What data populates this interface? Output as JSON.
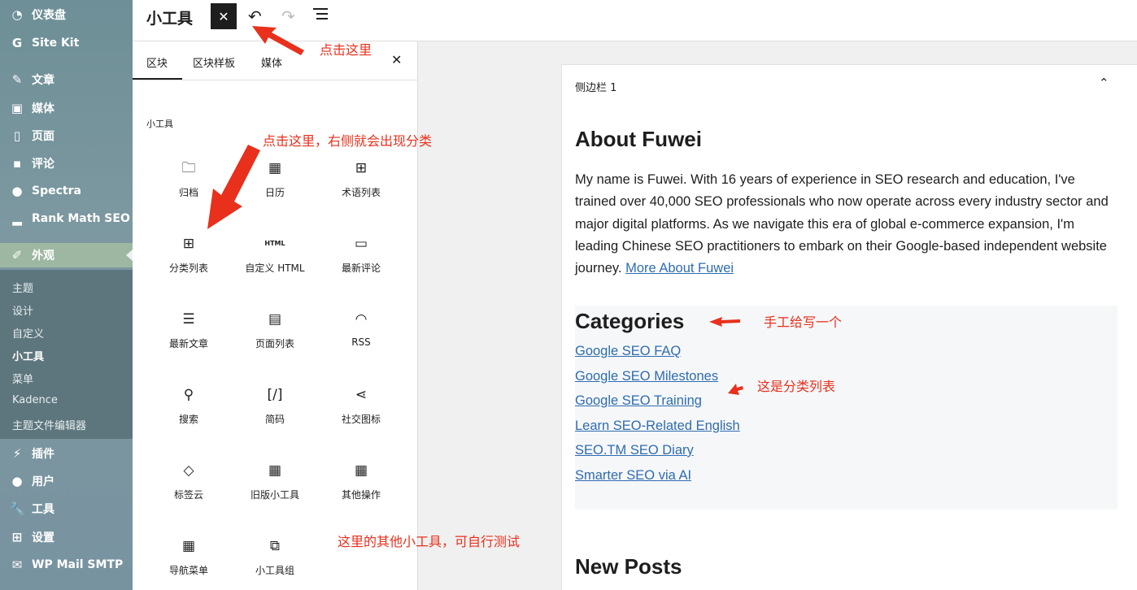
{
  "sidebar": {
    "items": [
      {
        "label": "仪表盘",
        "icon": "dashboard-icon"
      },
      {
        "label": "Site Kit",
        "icon": "google-icon"
      },
      {
        "label": "文章",
        "icon": "pin-icon"
      },
      {
        "label": "媒体",
        "icon": "media-icon"
      },
      {
        "label": "页面",
        "icon": "pages-icon"
      },
      {
        "label": "评论",
        "icon": "comments-icon"
      },
      {
        "label": "Spectra",
        "icon": "spectra-icon"
      },
      {
        "label": "Rank Math SEO",
        "icon": "chart-icon"
      },
      {
        "label": "外观",
        "icon": "appearance-icon"
      },
      {
        "label": "插件",
        "icon": "plugins-icon"
      },
      {
        "label": "用户",
        "icon": "users-icon"
      },
      {
        "label": "工具",
        "icon": "tools-icon"
      },
      {
        "label": "设置",
        "icon": "settings-icon"
      },
      {
        "label": "WP Mail SMTP",
        "icon": "mail-icon"
      }
    ],
    "submenu": [
      "主题",
      "设计",
      "自定义",
      "小工具",
      "菜单",
      "Kadence",
      "主题文件编辑器"
    ]
  },
  "toolbar": {
    "title": "小工具",
    "close_symbol": "✕",
    "undo_symbol": "↶",
    "redo_symbol": "↷"
  },
  "inserter": {
    "tabs": [
      "区块",
      "区块样板",
      "媒体"
    ],
    "close_symbol": "✕",
    "category": "小工具",
    "blocks": [
      {
        "label": "归档",
        "glyph": "🗀"
      },
      {
        "label": "日历",
        "glyph": "▦"
      },
      {
        "label": "术语列表",
        "glyph": "⊞"
      },
      {
        "label": "分类列表",
        "glyph": "⊞"
      },
      {
        "label": "自定义 HTML",
        "glyph": "HTML"
      },
      {
        "label": "最新评论",
        "glyph": "▭"
      },
      {
        "label": "最新文章",
        "glyph": "☰"
      },
      {
        "label": "页面列表",
        "glyph": "▤"
      },
      {
        "label": "RSS",
        "glyph": "◠"
      },
      {
        "label": "搜索",
        "glyph": "⚲"
      },
      {
        "label": "简码",
        "glyph": "[/]"
      },
      {
        "label": "社交图标",
        "glyph": "⋖"
      },
      {
        "label": "标签云",
        "glyph": "◇"
      },
      {
        "label": "旧版小工具",
        "glyph": "▦"
      },
      {
        "label": "其他操作",
        "glyph": "▦"
      },
      {
        "label": "导航菜单",
        "glyph": "▦"
      },
      {
        "label": "小工具组",
        "glyph": "⧉"
      }
    ]
  },
  "canvas": {
    "area_title": "侧边栏 1",
    "toggle_symbol": "⌃",
    "about_heading": "About Fuwei",
    "about_text": "My name is Fuwei. With 16 years of experience in SEO research and education, I've trained over 40,000 SEO professionals who now operate across every industry sector and major digital platforms. As we navigate this era of global e-commerce expansion, I'm leading Chinese SEO practitioners to embark on their Google-based independent website journey.",
    "about_link": "More About Fuwei",
    "categories_heading": "Categories",
    "categories": [
      "Google SEO FAQ",
      "Google SEO Milestones",
      "Google SEO Training",
      "Learn SEO-Related English",
      "SEO.TM SEO Diary",
      "Smarter SEO via AI"
    ],
    "new_posts_heading": "New Posts"
  },
  "annotations": {
    "click_here": "点击这里",
    "click_here_categories": "点击这里，右侧就会出现分类",
    "manual_heading": "手工给写一个",
    "category_list": "这是分类列表",
    "other_widgets": "这里的其他小工具，可自行测试",
    "color": "#e8301c"
  }
}
